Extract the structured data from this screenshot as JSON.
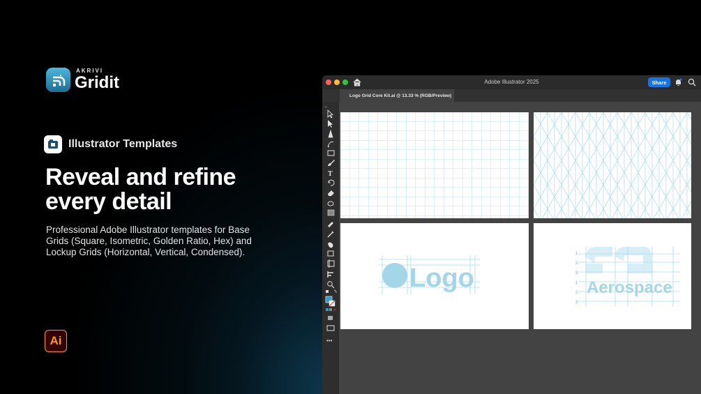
{
  "brand": {
    "sup": "AKRIVI",
    "name": "Gridit"
  },
  "badge": {
    "label": "Illustrator Templates"
  },
  "headline": {
    "line1": "Reveal and refine",
    "line2": "every detail"
  },
  "description": "Professional Adobe Illustrator templates for Base Grids (Square, Isometric, Golden Ratio, Hex) and Lockup Grids (Horizontal, Vertical, Condensed).",
  "ai_badge": "Ai",
  "window": {
    "title": "Adobe Illustrator 2025",
    "share_label": "Share",
    "tab_label": "Logo Grid Core Kit.ai @ 13.33 % (RGB/Preview)",
    "tab_close": "×"
  },
  "artboards": {
    "logo_text": "Logo",
    "wordmark_text": "Aerospace",
    "grid_numbers": [
      "1",
      "2",
      "3",
      "1",
      "2",
      "3"
    ]
  },
  "colors": {
    "grid_line": "#a9dcec",
    "logo_fill": "#a4d6ea",
    "accent_blue": "#1473e6",
    "ai_orange": "#ff9a00",
    "ai_bg": "#330000"
  },
  "toolbar": {
    "tools": [
      "selection-tool",
      "direct-selection-tool",
      "pen-tool",
      "curvature-tool",
      "rectangle-tool",
      "brush-tool",
      "type-tool",
      "rotate-tool",
      "eraser-tool",
      "shape-builder-tool",
      "gradient-tool",
      "eyedropper-tool",
      "blend-tool",
      "symbol-tool",
      "artboard-tool",
      "align-tool",
      "zoom-tool"
    ],
    "more_label": "•••"
  }
}
